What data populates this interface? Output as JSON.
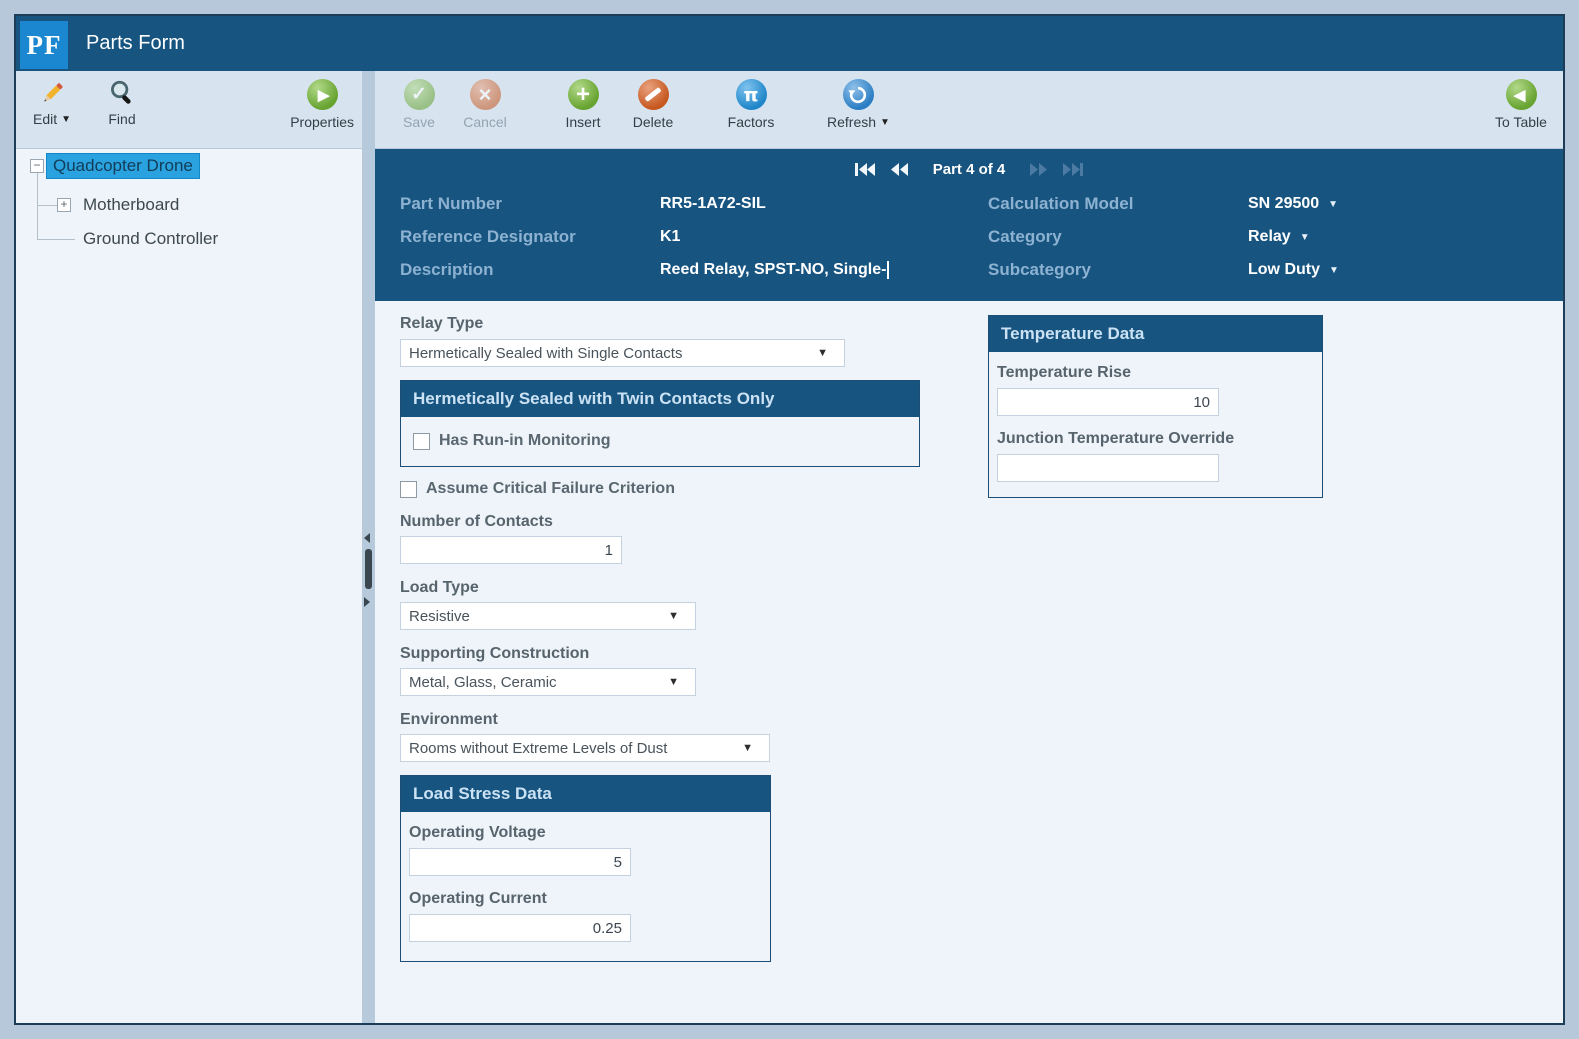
{
  "window": {
    "logo_text": "PF",
    "title": "Parts Form"
  },
  "left_toolbar": {
    "edit_label": "Edit",
    "find_label": "Find",
    "properties_label": "Properties"
  },
  "tree": {
    "items": [
      {
        "label": "Quadcopter Drone",
        "expander": "minus",
        "selected": true
      },
      {
        "label": "Motherboard",
        "expander": "plus",
        "selected": false
      },
      {
        "label": "Ground Controller",
        "expander": "none",
        "selected": false
      }
    ],
    "expander_minus": "−",
    "expander_plus": "+"
  },
  "toolbar": {
    "save_label": "Save",
    "cancel_label": "Cancel",
    "insert_label": "Insert",
    "delete_label": "Delete",
    "factors_label": "Factors",
    "refresh_label": "Refresh",
    "to_table_label": "To Table",
    "save_enabled": false,
    "cancel_enabled": false
  },
  "icons": {
    "check": "✓",
    "cross": "×",
    "plus": "+",
    "pi": "π",
    "play": "▶",
    "back": "◀",
    "dropdown": "▾"
  },
  "record_nav": {
    "position_text": "Part 4 of 4",
    "first_enabled": true,
    "prev_enabled": true,
    "next_enabled": false,
    "last_enabled": false
  },
  "header_fields": {
    "part_number": {
      "label": "Part Number",
      "value": "RR5-1A72-SIL"
    },
    "reference_designator": {
      "label": "Reference Designator",
      "value": "K1"
    },
    "description": {
      "label": "Description",
      "value": "Reed Relay, SPST-NO, Single-"
    },
    "calculation_model": {
      "label": "Calculation Model",
      "value": "SN 29500"
    },
    "category": {
      "label": "Category",
      "value": "Relay"
    },
    "subcategory": {
      "label": "Subcategory",
      "value": "Low Duty"
    }
  },
  "form": {
    "relay_type": {
      "label": "Relay Type",
      "value": "Hermetically Sealed with Single Contacts"
    },
    "twin_contacts_group": {
      "title": "Hermetically Sealed with Twin Contacts Only",
      "has_run_in_monitoring": {
        "label": "Has Run-in Monitoring",
        "checked": false
      }
    },
    "assume_critical_failure": {
      "label": "Assume Critical Failure Criterion",
      "checked": false
    },
    "number_of_contacts": {
      "label": "Number of Contacts",
      "value": "1"
    },
    "load_type": {
      "label": "Load Type",
      "value": "Resistive"
    },
    "supporting_construction": {
      "label": "Supporting Construction",
      "value": "Metal, Glass, Ceramic"
    },
    "environment": {
      "label": "Environment",
      "value": "Rooms without Extreme Levels of Dust"
    },
    "load_stress_group": {
      "title": "Load Stress Data",
      "operating_voltage": {
        "label": "Operating Voltage",
        "value": "5"
      },
      "operating_current": {
        "label": "Operating Current",
        "value": "0.25"
      }
    },
    "temperature_group": {
      "title": "Temperature Data",
      "temperature_rise": {
        "label": "Temperature Rise",
        "value": "10"
      },
      "junction_temperature_override": {
        "label": "Junction Temperature Override",
        "value": ""
      }
    }
  },
  "colors": {
    "navy": "#175480",
    "logo_blue": "#1b87d0",
    "selected_blue": "#29a2df",
    "toolbar_bg": "#d7e4f0",
    "panel_bg": "#eef4f9",
    "page_bg": "#b6c8da"
  }
}
